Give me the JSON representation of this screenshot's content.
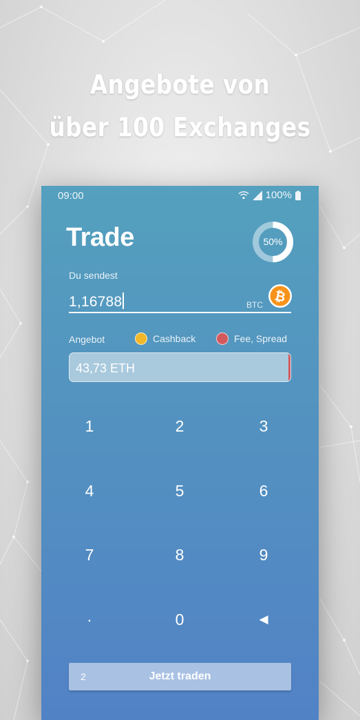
{
  "headline": {
    "line1": "Angebote von",
    "line2": "über 100 Exchanges"
  },
  "status_bar": {
    "time": "09:00",
    "battery": "100%",
    "icons": [
      "wifi-icon",
      "cell-signal-icon",
      "battery-icon"
    ]
  },
  "screen": {
    "title": "Trade",
    "progress": {
      "label": "50%",
      "value": 0.5
    },
    "send": {
      "label": "Du sendest",
      "value": "1,16788",
      "currency": "BTC",
      "currency_icon": "bitcoin-icon"
    },
    "offer": {
      "label": "Angebot",
      "legend": [
        {
          "label": "Cashback",
          "color": "#f2b82a"
        },
        {
          "label": "Fee, Spread",
          "color": "#d25a5e"
        }
      ],
      "value": "43,73 ETH"
    },
    "keypad": {
      "keys": [
        "1",
        "2",
        "3",
        "4",
        "5",
        "6",
        "7",
        "8",
        "9",
        "·",
        "0",
        "◀"
      ]
    },
    "trade_button": {
      "label": "Jetzt traden",
      "count": "2"
    }
  },
  "colors": {
    "accent_orange": "#f7931a",
    "cashback_yellow": "#f2b82a",
    "fee_red": "#d25a5e",
    "screen_top": "#54a0be",
    "screen_bottom": "#5282c6"
  }
}
